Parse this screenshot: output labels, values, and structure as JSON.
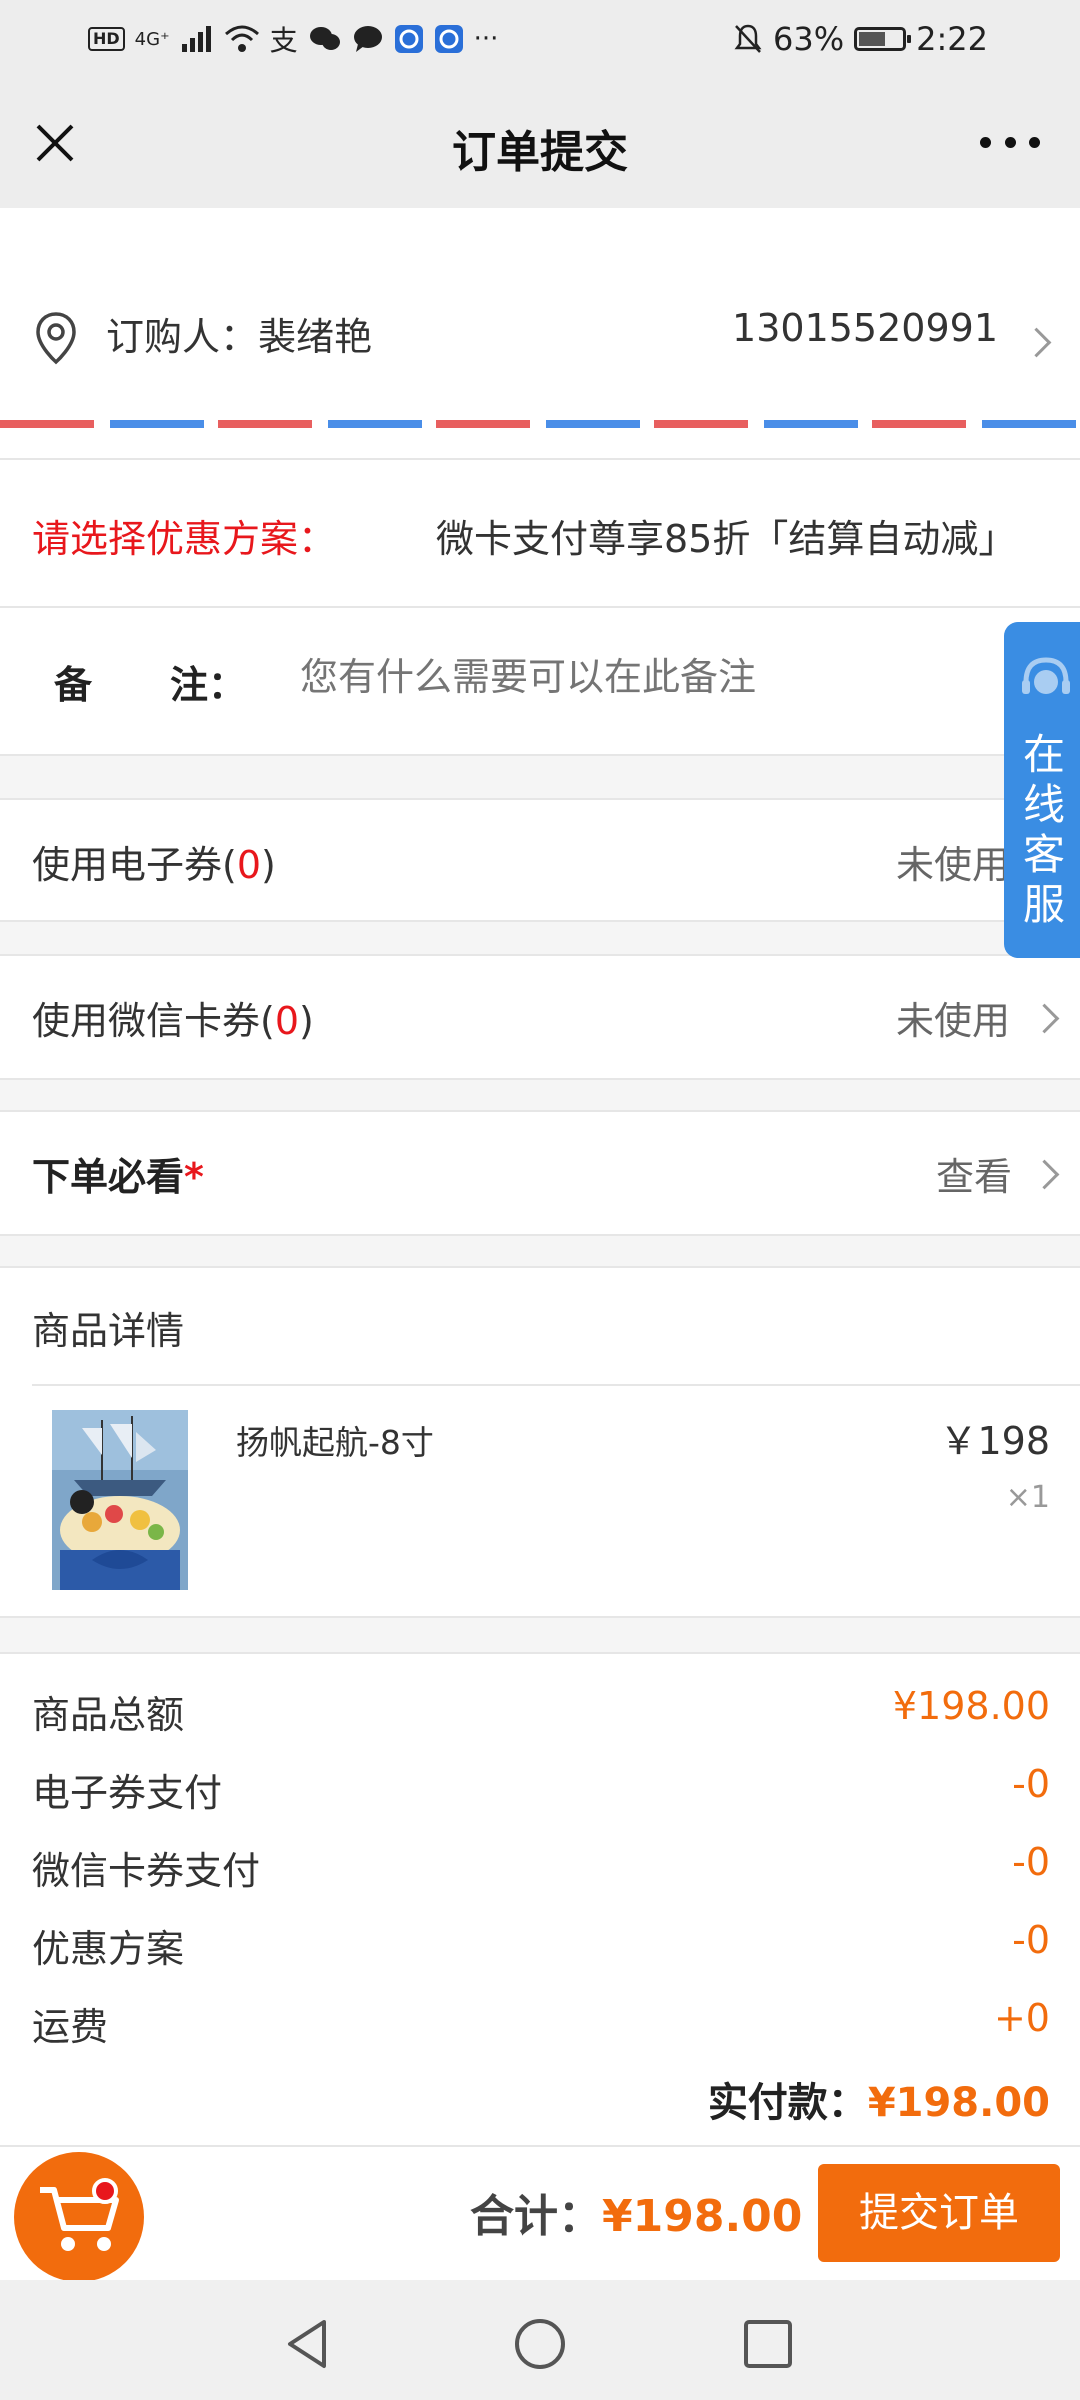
{
  "status_bar": {
    "left_badge": "HD",
    "network": "4G⁺",
    "more": "···",
    "battery": "63%",
    "battery_level": 0.63,
    "time": "2:22"
  },
  "nav": {
    "title": "订单提交"
  },
  "buyer": {
    "label": "订购人：裴绪艳",
    "phone": "13015520991"
  },
  "discount": {
    "label": "请选择优惠方案：",
    "value": "微卡支付尊享85折「结算自动减」"
  },
  "remark": {
    "label1": "备",
    "label2": "注：",
    "placeholder": "您有什么需要可以在此备注"
  },
  "service_tab": {
    "label": "在线客服",
    "chars": [
      "在",
      "线",
      "客",
      "服"
    ]
  },
  "e_coupon": {
    "label": "使用电子券(",
    "count": "0",
    "close": ")",
    "value": "未使用"
  },
  "wechat_coupon": {
    "label": "使用微信卡券(",
    "count": "0",
    "close": ")",
    "value": "未使用"
  },
  "must_read": {
    "label": "下单必看",
    "star": "*",
    "value": "查看"
  },
  "product_section": {
    "title": "商品详情"
  },
  "product": {
    "name": "扬帆起航-8寸",
    "price": "￥198",
    "qty_prefix": "×",
    "qty": "1"
  },
  "summary": {
    "rows": [
      {
        "label": "商品总额",
        "value": "¥198.00"
      },
      {
        "label": "电子券支付",
        "value": "-0"
      },
      {
        "label": "微信卡券支付",
        "value": "-0"
      },
      {
        "label": "优惠方案",
        "value": "-0"
      },
      {
        "label": "运费",
        "value": "+0"
      }
    ],
    "paid_label": "实付款：",
    "paid_value": "¥198.00"
  },
  "bottom": {
    "total_label": "合计：",
    "total_value": "¥198.00",
    "submit": "提交订单"
  },
  "colors": {
    "accent": "#f26c0d",
    "red": "#e8171c",
    "service_blue": "#3a8de3"
  }
}
